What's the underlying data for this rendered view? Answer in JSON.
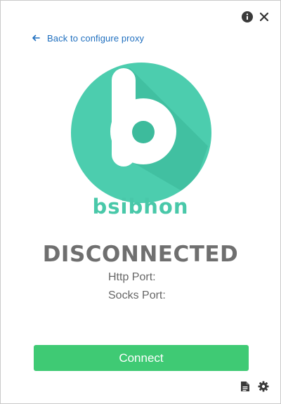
{
  "nav": {
    "back_label": "Back to configure proxy"
  },
  "brand": {
    "name": "bsibhon"
  },
  "status": {
    "state": "DISCONNECTED",
    "http_port_label": "Http Port:",
    "socks_port_label": "Socks Port:"
  },
  "actions": {
    "connect_label": "Connect"
  },
  "icons": {
    "info": "info-icon",
    "close": "close-icon",
    "back": "arrow-left-icon",
    "log": "document-icon",
    "settings": "gear-icon"
  },
  "colors": {
    "brand": "#49c8a9",
    "logo_circle": "#4ccdae",
    "connect_button": "#3fca74",
    "link": "#1f6fbf",
    "status_text": "#6f6f6f"
  }
}
